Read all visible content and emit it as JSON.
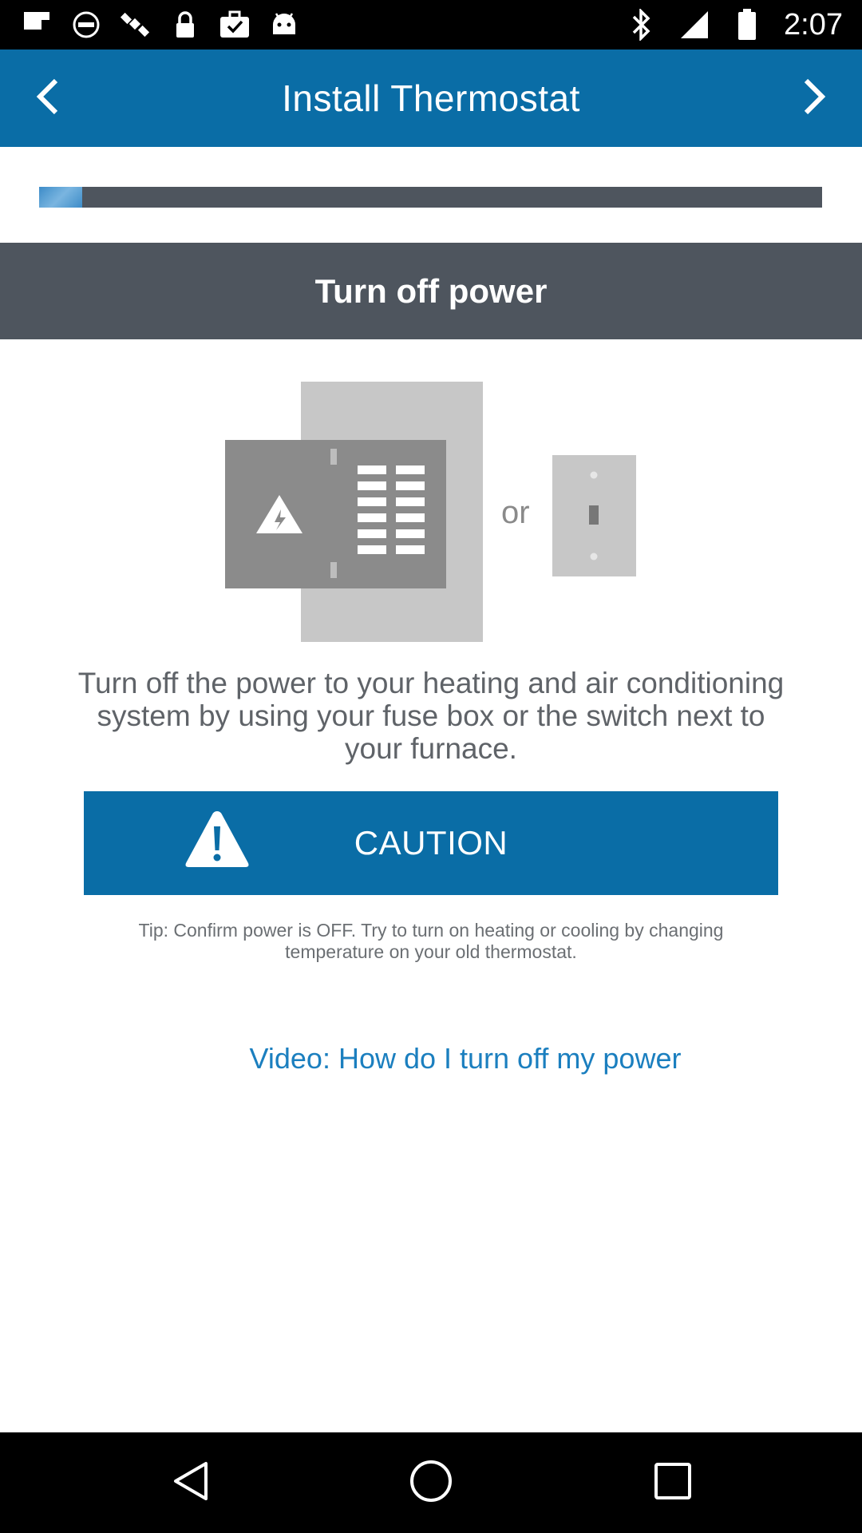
{
  "status_bar": {
    "time": "2:07",
    "left_icons": [
      "flipboard-icon",
      "fake-gps-icon",
      "satellite-icon",
      "lock-icon",
      "briefcase-check-icon",
      "android-icon"
    ],
    "right_icons": [
      "bluetooth-icon"
    ]
  },
  "app_bar": {
    "title": "Install Thermostat",
    "back_icon": "chevron-left-icon",
    "next_icon": "chevron-right-icon",
    "color": "#0a6da6"
  },
  "progress": {
    "value": 0.055,
    "track_color": "#4e555e"
  },
  "step": {
    "title": "Turn off power",
    "illustration_or": "or",
    "description": "Turn off the power to your heating and air conditioning system by using your fuse box or the switch next to your furnace."
  },
  "caution": {
    "label": "CAUTION",
    "icon": "warning-icon"
  },
  "tip": "Tip: Confirm power is OFF. Try to turn on heating or cooling by changing temperature on your old thermostat.",
  "video_link": "Video: How do I turn off my power",
  "system_nav": {
    "back_icon": "nav-back-icon",
    "home_icon": "nav-home-icon",
    "recents_icon": "nav-recents-icon"
  }
}
